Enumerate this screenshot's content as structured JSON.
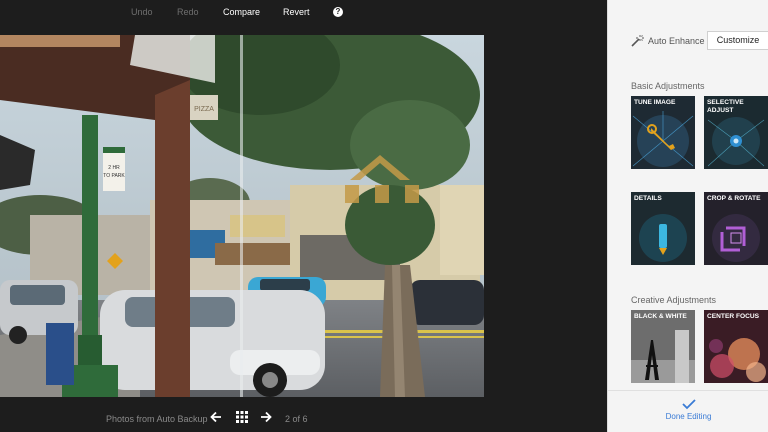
{
  "toolbar": {
    "undo": "Undo",
    "redo": "Redo",
    "compare": "Compare",
    "revert": "Revert",
    "help": "?"
  },
  "bottombar": {
    "source": "Photos from Auto Backup",
    "count": "2 of 6"
  },
  "panel": {
    "auto_enhance": "Auto Enhance",
    "customize": "Customize",
    "basic_title": "Basic Adjustments",
    "creative_title": "Creative Adjustments",
    "tiles": {
      "tune": "TUNE IMAGE",
      "selective_line1": "SELECTIVE",
      "selective_line2": "ADJUST",
      "details": "DETAILS",
      "crop": "CROP & ROTATE",
      "bw": "BLACK & WHITE",
      "center": "CENTER FOCUS"
    },
    "done": "Done Editing"
  },
  "photo": {
    "sign_text": "PIZZA",
    "parking_sign_line1": "2 HR",
    "parking_sign_line2": "TO PARK"
  },
  "colors": {
    "accent": "#3a7bd5",
    "editor_bg": "#1d1d1d",
    "panel_bg": "#f4f4f4"
  }
}
